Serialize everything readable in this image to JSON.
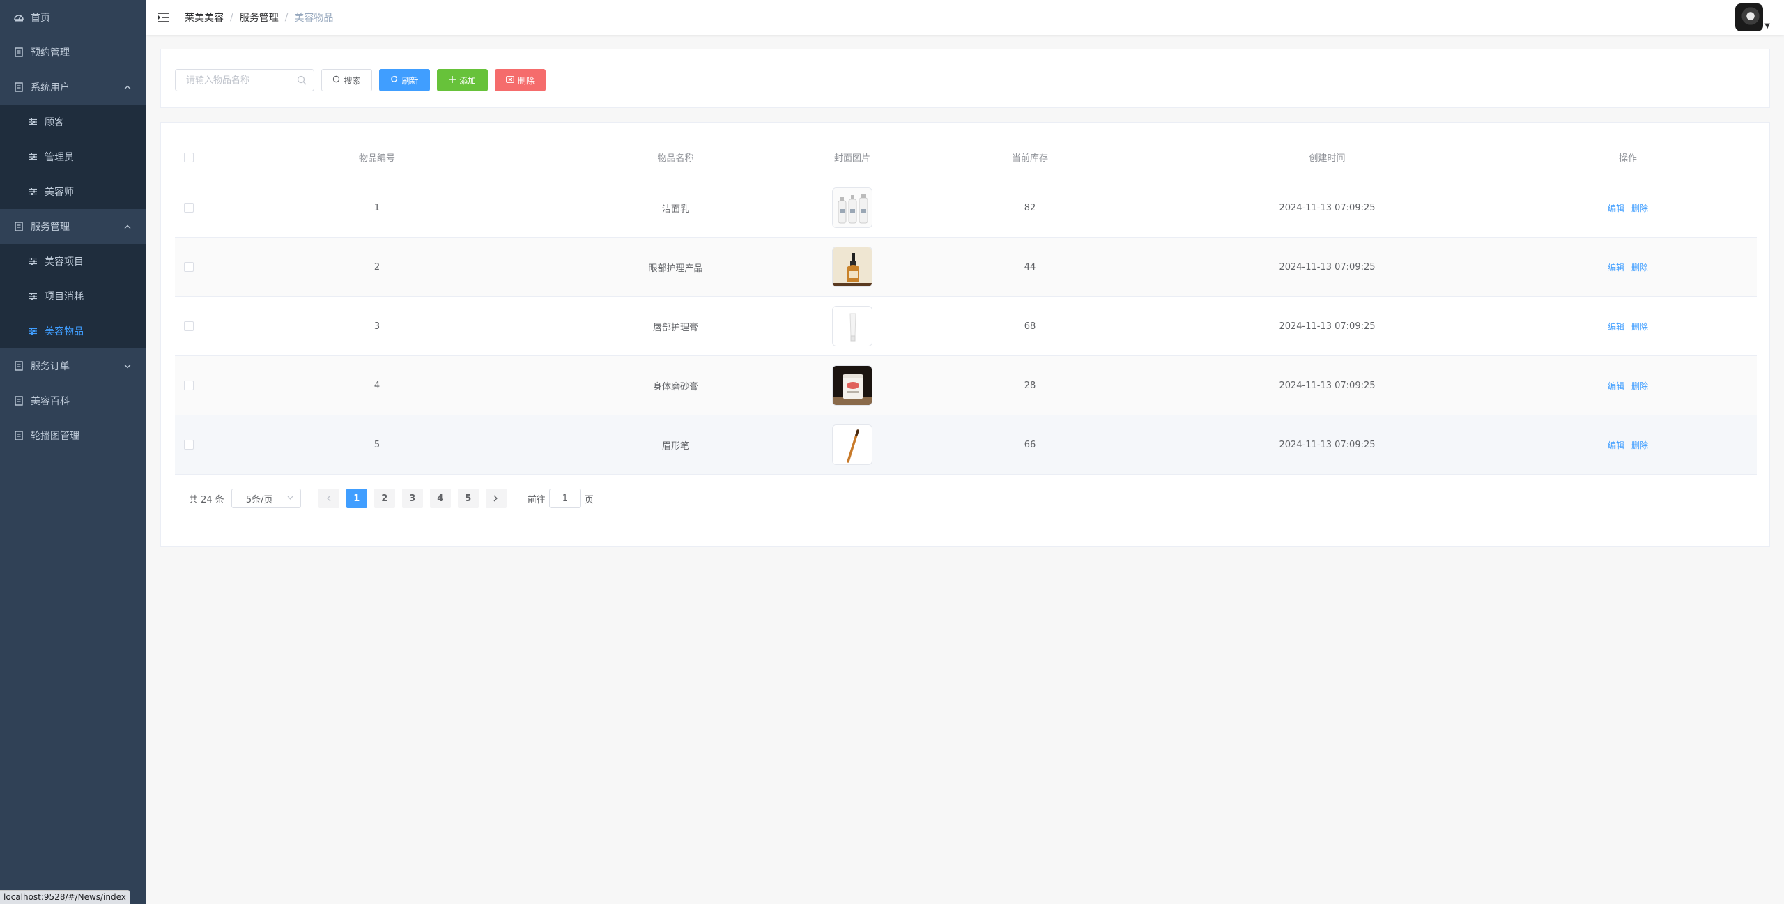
{
  "sidebar": {
    "items": [
      {
        "label": "首页",
        "icon": "dashboard-icon"
      },
      {
        "label": "预约管理",
        "icon": "document-icon"
      },
      {
        "label": "系统用户",
        "icon": "document-icon",
        "expanded": true,
        "children": [
          {
            "label": "顾客"
          },
          {
            "label": "管理员"
          },
          {
            "label": "美容师"
          }
        ]
      },
      {
        "label": "服务管理",
        "icon": "document-icon",
        "expanded": true,
        "children": [
          {
            "label": "美容项目"
          },
          {
            "label": "项目消耗"
          },
          {
            "label": "美容物品",
            "active": true
          }
        ]
      },
      {
        "label": "服务订单",
        "icon": "document-icon",
        "expanded": false
      },
      {
        "label": "美容百科",
        "icon": "document-icon"
      },
      {
        "label": "轮播图管理",
        "icon": "document-icon"
      }
    ]
  },
  "breadcrumb": [
    "莱美美容",
    "服务管理",
    "美容物品"
  ],
  "toolbar": {
    "search_placeholder": "请输入物品名称",
    "search_label": "搜索",
    "refresh_label": "刷新",
    "add_label": "添加",
    "delete_label": "删除"
  },
  "table": {
    "headers": [
      "物品编号",
      "物品名称",
      "封面图片",
      "当前库存",
      "创建时间",
      "操作"
    ],
    "rows": [
      {
        "id": "1",
        "name": "洁面乳",
        "image": "cleanser-bottles",
        "stock": "82",
        "created": "2024-11-13 07:09:25"
      },
      {
        "id": "2",
        "name": "眼部护理产品",
        "image": "serum-dropper",
        "stock": "44",
        "created": "2024-11-13 07:09:25"
      },
      {
        "id": "3",
        "name": "唇部护理膏",
        "image": "lip-tube",
        "stock": "68",
        "created": "2024-11-13 07:09:25"
      },
      {
        "id": "4",
        "name": "身体磨砂膏",
        "image": "scrub-jar",
        "stock": "28",
        "created": "2024-11-13 07:09:25"
      },
      {
        "id": "5",
        "name": "眉形笔",
        "image": "brow-pencil",
        "stock": "66",
        "created": "2024-11-13 07:09:25"
      }
    ],
    "edit_label": "编辑",
    "delete_label": "删除"
  },
  "pagination": {
    "total": "共 24 条",
    "page_size": "5条/页",
    "pages": [
      "1",
      "2",
      "3",
      "4",
      "5"
    ],
    "current": "1",
    "goto_prefix": "前往",
    "goto_value": "1",
    "goto_suffix": "页"
  },
  "statusbar": {
    "url": "localhost:9528/#/News/index"
  },
  "colors": {
    "sidebar_bg": "#304156",
    "submenu_bg": "#1f2d3d",
    "primary": "#409eff",
    "success": "#67c23a",
    "danger": "#f56c6c"
  }
}
